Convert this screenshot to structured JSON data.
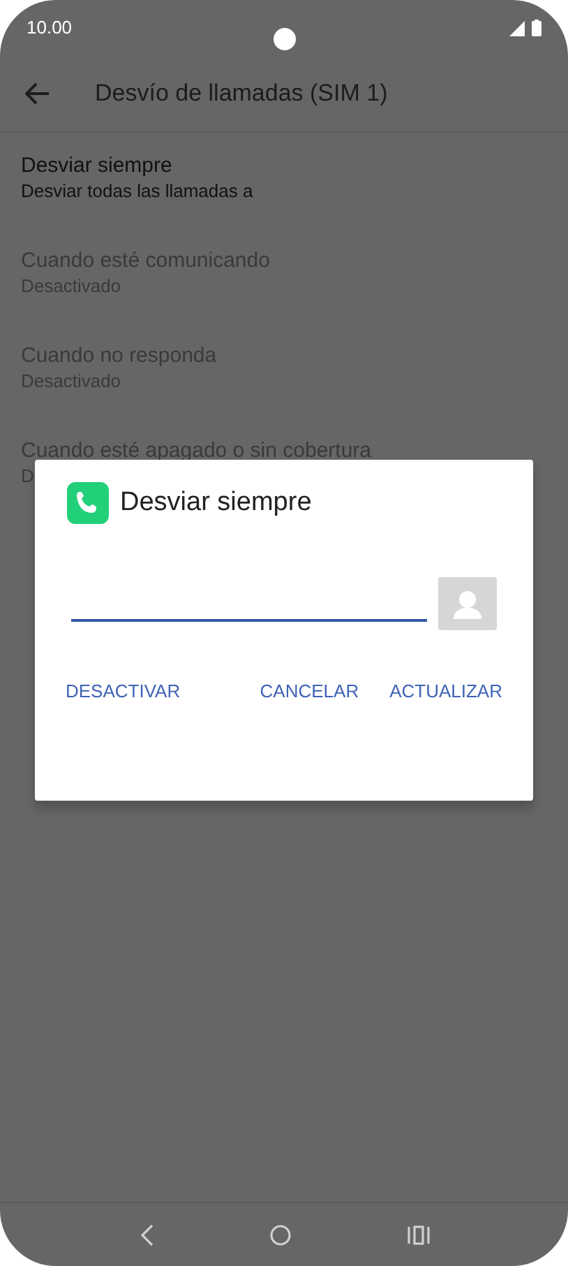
{
  "status_bar": {
    "time": "10.00"
  },
  "header": {
    "title": "Desvío de llamadas (SIM 1)"
  },
  "items": [
    {
      "title": "Desviar siempre",
      "subtitle": "Desviar todas las llamadas a",
      "disabled": false
    },
    {
      "title": "Cuando esté comunicando",
      "subtitle": "Desactivado",
      "disabled": true
    },
    {
      "title": "Cuando no responda",
      "subtitle": "Desactivado",
      "disabled": true
    },
    {
      "title": "Cuando esté apagado o sin cobertura",
      "subtitle": "D",
      "disabled": true
    }
  ],
  "dialog": {
    "title": "Desviar siempre",
    "buttons": [
      "DESACTIVAR",
      "CANCELAR",
      "ACTUALIZAR"
    ]
  }
}
